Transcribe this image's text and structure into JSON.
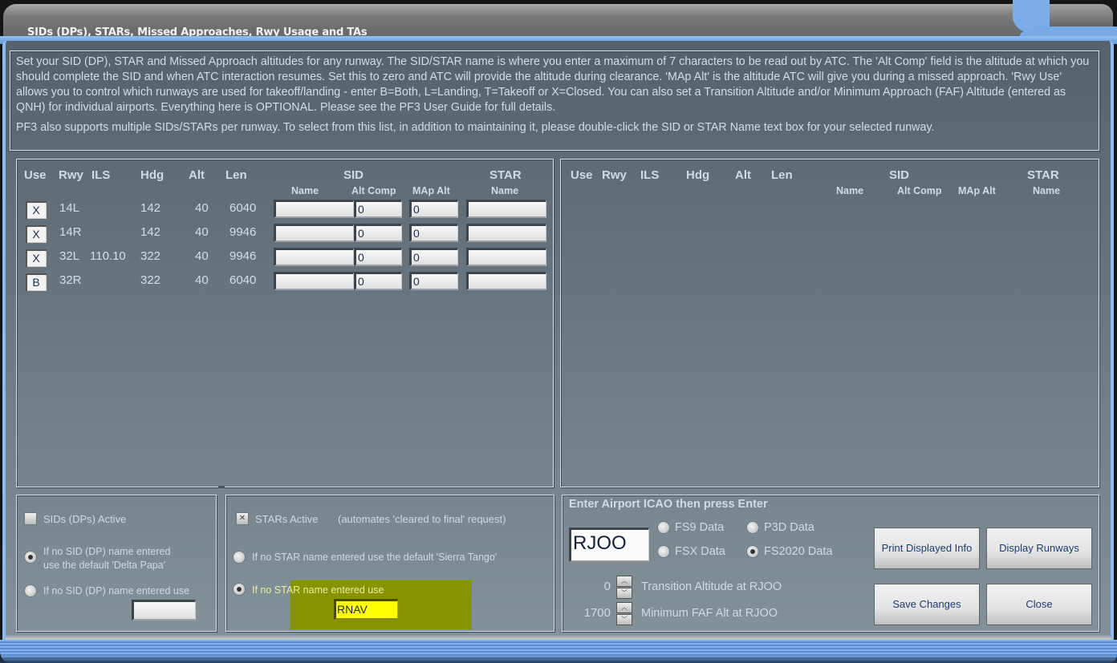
{
  "window": {
    "title": "SIDs (DPs), STARs, Missed Approaches, Rwy Usage and TAs"
  },
  "info": {
    "paragraph1": "Set your SID (DP), STAR and Missed Approach altitudes for any runway. The SID/STAR name is where you enter a maximum of 7 characters to be read out by ATC. The 'Alt Comp' field is the altitude at which you should complete the SID and when ATC interaction resumes. Set this to zero and ATC will provide the altitude during clearance. 'MAp Alt' is the altitude ATC will give you during a missed approach. 'Rwy Use' allows you to control which runways are used for takeoff/landing - enter B=Both, L=Landing, T=Takeoff or X=Closed.  You can also set a Transition Altitude and/or Minimum Approach (FAF) Altitude (entered as QNH) for individual airports. Everything here is OPTIONAL. Please see the PF3 User Guide for full details.",
    "paragraph2": "PF3 also supports multiple SIDs/STARs per runway. To select from this list, in addition to maintaining it, please double-click the SID or STAR Name text box for your selected runway."
  },
  "table_headers": {
    "use": "Use",
    "rwy": "Rwy",
    "ils": "ILS",
    "hdg": "Hdg",
    "alt": "Alt",
    "len": "Len",
    "sid": "SID",
    "star": "STAR",
    "name": "Name",
    "alt_comp": "Alt Comp",
    "map_alt": "MAp Alt",
    "star_name": "Name"
  },
  "runways_left": [
    {
      "use": "X",
      "rwy": "14L",
      "ils": "",
      "hdg": "142",
      "alt": "40",
      "len": "6040",
      "sid_name": "",
      "alt_comp": "0",
      "map_alt": "0",
      "star_name": ""
    },
    {
      "use": "X",
      "rwy": "14R",
      "ils": "",
      "hdg": "142",
      "alt": "40",
      "len": "9946",
      "sid_name": "",
      "alt_comp": "0",
      "map_alt": "0",
      "star_name": ""
    },
    {
      "use": "X",
      "rwy": "32L",
      "ils": "110.10",
      "hdg": "322",
      "alt": "40",
      "len": "9946",
      "sid_name": "",
      "alt_comp": "0",
      "map_alt": "0",
      "star_name": ""
    },
    {
      "use": "B",
      "rwy": "32R",
      "ils": "",
      "hdg": "322",
      "alt": "40",
      "len": "6040",
      "sid_name": "",
      "alt_comp": "0",
      "map_alt": "0",
      "star_name": ""
    }
  ],
  "sids_panel": {
    "active_label": "SIDs (DPs) Active",
    "active_checked": false,
    "option_default": "If no SID (DP) name entered use the default 'Delta Papa'",
    "option_default_line1": "If no SID (DP) name entered",
    "option_default_line2": "use the default 'Delta Papa'",
    "option_custom": "If no SID (DP) name entered use",
    "selected": "default",
    "custom_value": ""
  },
  "stars_panel": {
    "active_label": "STARs Active",
    "active_note": "(automates 'cleared to final' request)",
    "active_checked": true,
    "option_default": "If no STAR name entered use the default 'Sierra Tango'",
    "option_custom": "If no STAR name entered use",
    "selected": "custom",
    "custom_value": "RNAV",
    "highlight_color": "#859400"
  },
  "airport_panel": {
    "heading": "Enter Airport ICAO then press Enter",
    "icao": "RJOO",
    "data_sources": [
      {
        "label": "FS9 Data",
        "selected": false
      },
      {
        "label": "P3D Data",
        "selected": false
      },
      {
        "label": "FSX Data",
        "selected": false
      },
      {
        "label": "FS2020 Data",
        "selected": true
      }
    ],
    "transition_altitude": "0",
    "transition_label": "Transition Altitude at RJOO",
    "min_faf_alt": "1700",
    "min_faf_label": "Minimum FAF Alt at RJOO"
  },
  "buttons": {
    "print": "Print Displayed Info",
    "display_runways": "Display Runways",
    "save": "Save Changes",
    "close": "Close"
  },
  "icons": {
    "check_mark": "✕",
    "spin_up": "︿",
    "spin_down": "﹀"
  }
}
